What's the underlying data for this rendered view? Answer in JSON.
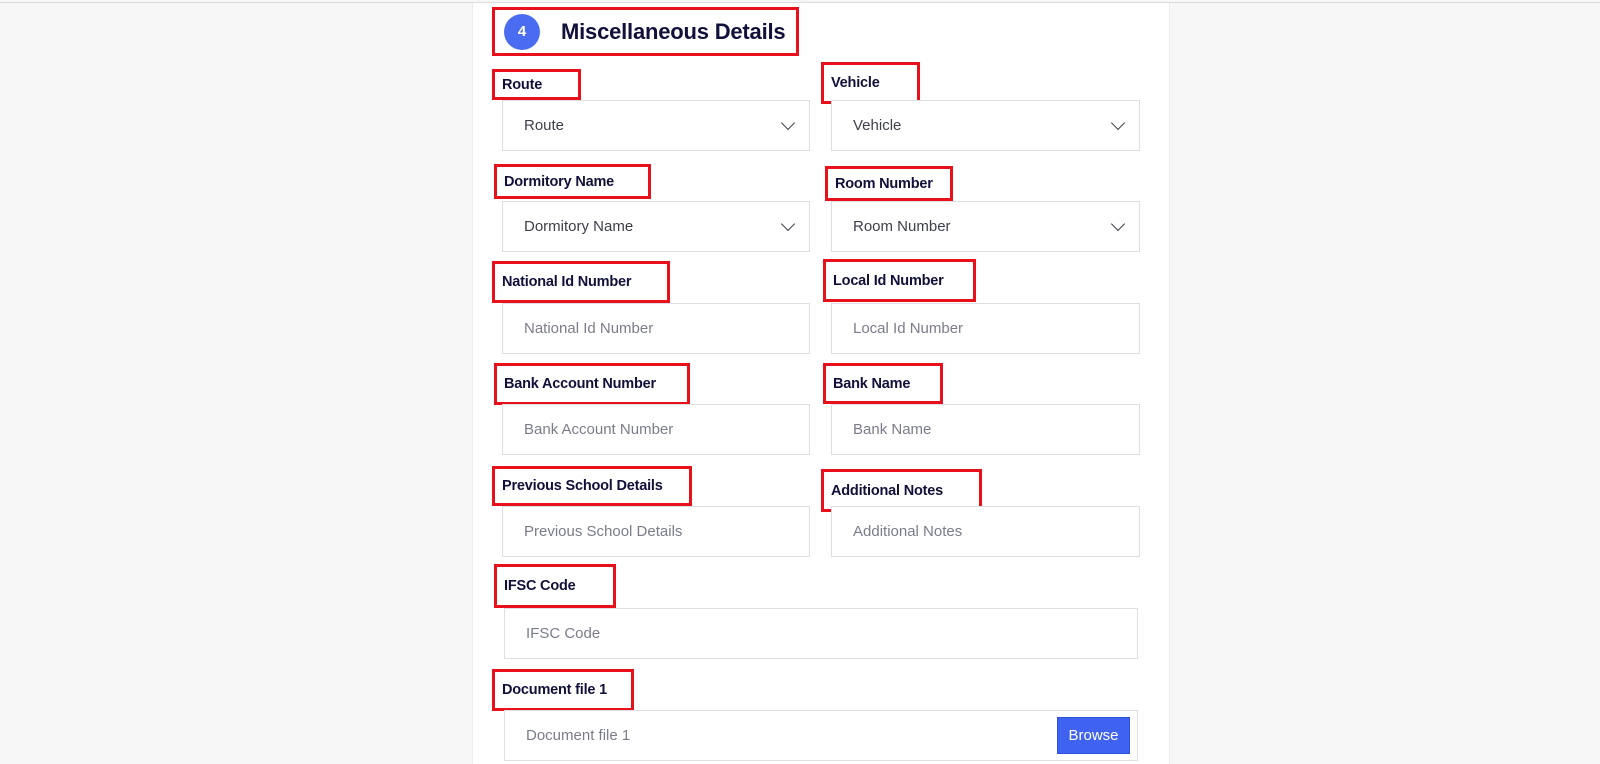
{
  "section": {
    "step": "4",
    "title": "Miscellaneous Details"
  },
  "fields": {
    "route": {
      "label": "Route",
      "placeholder": "Route"
    },
    "vehicle": {
      "label": "Vehicle",
      "placeholder": "Vehicle"
    },
    "dormitory": {
      "label": "Dormitory Name",
      "placeholder": "Dormitory Name"
    },
    "room": {
      "label": "Room Number",
      "placeholder": "Room Number"
    },
    "national_id": {
      "label": "National Id Number",
      "placeholder": "National Id Number"
    },
    "local_id": {
      "label": "Local Id Number",
      "placeholder": "Local Id Number"
    },
    "bank_account": {
      "label": "Bank Account Number",
      "placeholder": "Bank Account Number"
    },
    "bank_name": {
      "label": "Bank Name",
      "placeholder": "Bank Name"
    },
    "previous_school": {
      "label": "Previous School Details",
      "placeholder": "Previous School Details"
    },
    "notes": {
      "label": "Additional Notes",
      "placeholder": "Additional Notes"
    },
    "ifsc": {
      "label": "IFSC Code",
      "placeholder": "IFSC Code"
    },
    "document1": {
      "label": "Document file 1",
      "placeholder": "Document file 1",
      "button": "Browse"
    }
  },
  "colors": {
    "accent": "#3f63f0",
    "highlight": "#e8101a",
    "heading": "#10103a"
  }
}
